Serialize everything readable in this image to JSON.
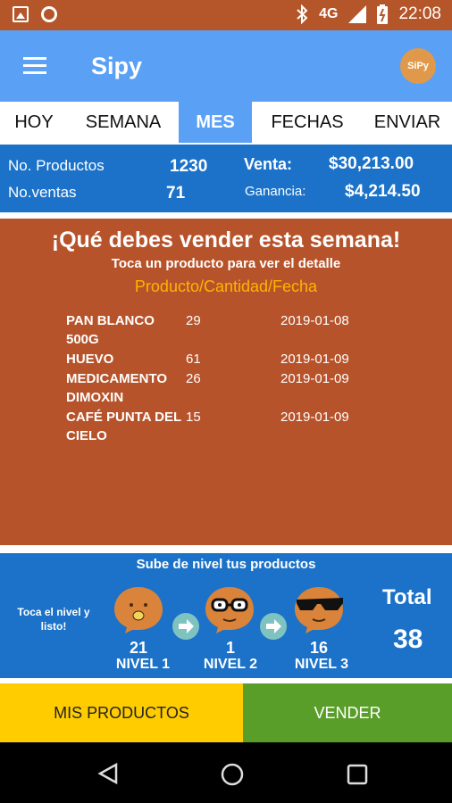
{
  "status_bar": {
    "network": "4G",
    "time": "22:08"
  },
  "app_bar": {
    "title": "Sipy",
    "logo_text": "SiPy"
  },
  "tabs": [
    {
      "label": "HOY"
    },
    {
      "label": "SEMANA"
    },
    {
      "label": "MES",
      "active": true
    },
    {
      "label": "FECHAS"
    },
    {
      "label": "ENVIAR"
    }
  ],
  "summary": {
    "products_label": "No. Productos",
    "products_value": "1230",
    "sales_count_label": "No.ventas",
    "sales_count_value": "71",
    "sales_label": "Venta:",
    "sales_value": "$30,213.00",
    "profit_label": "Ganancia:",
    "profit_value": "$4,214.50"
  },
  "week": {
    "title": "¡Qué debes  vender esta semana!",
    "subtitle": "Toca un producto para ver el detalle",
    "header": "Producto/Cantidad/Fecha",
    "products": [
      {
        "name": "PAN BLANCO 500G",
        "qty": "29",
        "date": "2019-01-08"
      },
      {
        "name": "HUEVO",
        "qty": "61",
        "date": "2019-01-09"
      },
      {
        "name": "MEDICAMENTO DIMOXIN",
        "qty": "26",
        "date": "2019-01-09"
      },
      {
        "name": "CAFÉ PUNTA DEL CIELO",
        "qty": "15",
        "date": "2019-01-09"
      }
    ]
  },
  "levels": {
    "title": "Sube de nivel tus productos",
    "hint": "Toca el nivel y listo!",
    "items": [
      {
        "count": "21",
        "name": "NIVEL 1"
      },
      {
        "count": "1",
        "name": "NIVEL 2"
      },
      {
        "count": "16",
        "name": "NIVEL 3"
      }
    ],
    "total_label": "Total",
    "total_value": "38"
  },
  "buttons": {
    "mis_productos": "MIS PRODUCTOS",
    "vender": "VENDER"
  },
  "colors": {
    "status_bar": "#b4562a",
    "app_bar": "#5aa1f5",
    "summary": "#1b72c8",
    "week_box": "#b7532a",
    "accent_header": "#ffb300",
    "btn_yellow": "#ffcc00",
    "btn_green": "#5a9e2a",
    "face": "#d9843a"
  }
}
